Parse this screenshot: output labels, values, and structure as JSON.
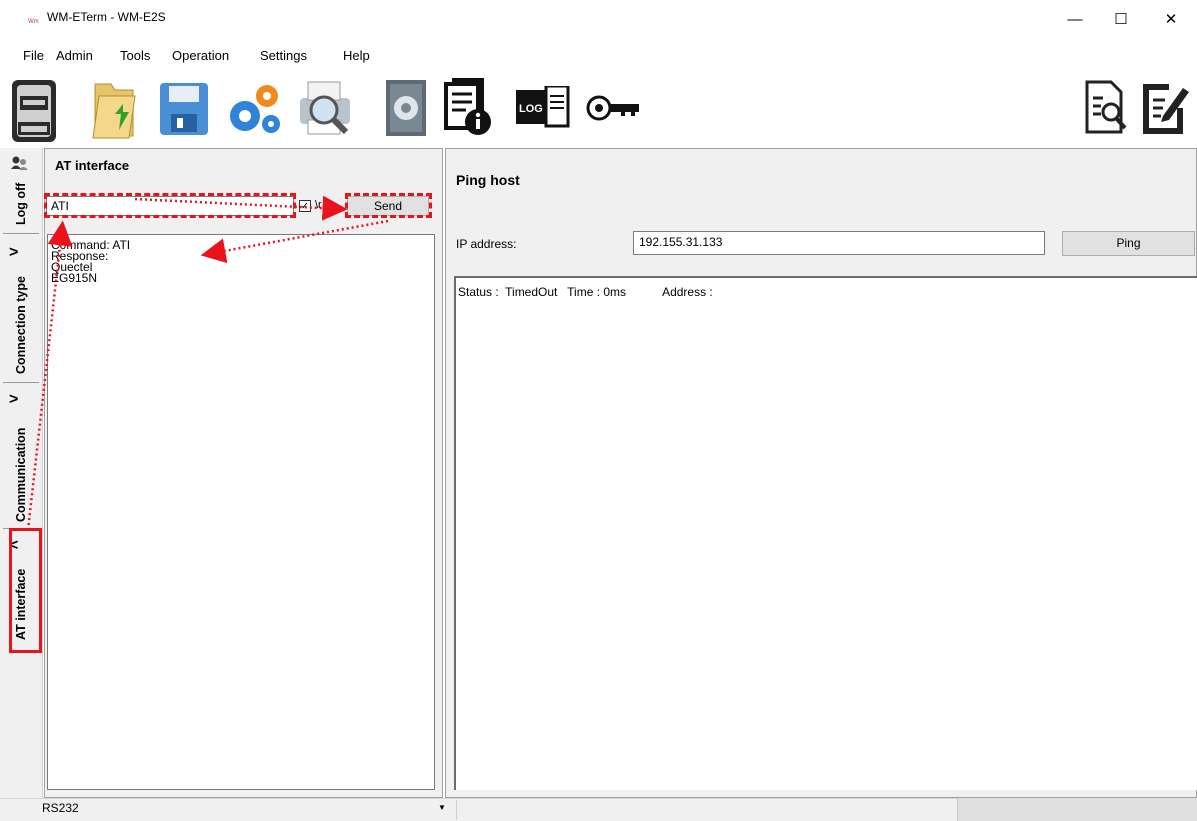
{
  "window": {
    "title": "WM-ETerm - WM-E2S",
    "app_icon_label": "Wm",
    "minimize": "—",
    "maximize": "☐",
    "close": "✕"
  },
  "menu": {
    "items": [
      "File",
      "Admin",
      "Tools",
      "Operation",
      "Settings",
      "Help"
    ]
  },
  "toolbar": {
    "icons": [
      "meter-icon",
      "folder-open-icon",
      "save-icon",
      "settings-gears-icon",
      "print-preview-icon",
      "firmware-book-icon",
      "device-info-icon",
      "log-icon",
      "key-icon",
      "report-view-icon",
      "edit-document-icon"
    ],
    "log_label": "LOG"
  },
  "sidebar": {
    "tabs": [
      {
        "label": "Log off"
      },
      {
        "label": "Connection type"
      },
      {
        "label": "Communication"
      },
      {
        "label": "AT interface"
      }
    ]
  },
  "at_interface": {
    "title": "AT interface",
    "command_value": "ATI",
    "cr_checked": true,
    "cr_label": "\\r",
    "send_label": "Send",
    "output": "Command: ATI\nResponse:\nQuectel\nEG915N"
  },
  "ping": {
    "title": "Ping host",
    "ip_label": "IP address:",
    "ip_value": "192.155.31.133",
    "button_label": "Ping",
    "status_line": "Status :  TimedOut   Time : 0ms           Address :"
  },
  "statusbar": {
    "port": "RS232"
  },
  "colors": {
    "annotation": "#e8131b",
    "panel_bg": "#f0f0f0",
    "button_bg": "#e1e1e1"
  }
}
